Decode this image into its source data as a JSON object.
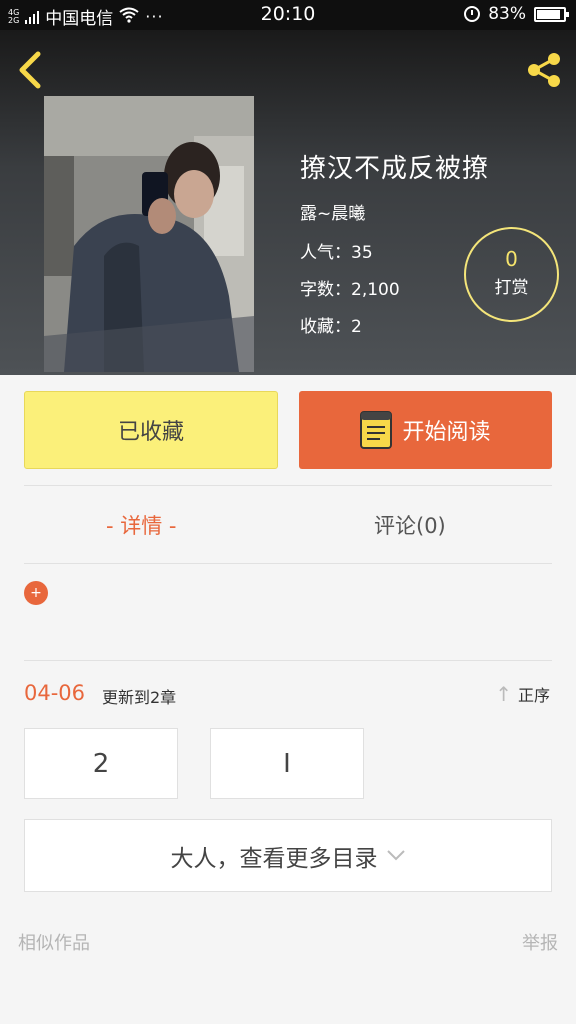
{
  "status_bar": {
    "network_top": "4G",
    "network_bottom": "2G",
    "carrier": "中国电信",
    "dots": "···",
    "time": "20:10",
    "battery": "83%",
    "battery_level": 0.83
  },
  "book": {
    "title": "撩汉不成反被撩",
    "author": "露~晨曦",
    "popularity": "人气：35",
    "word_count": "字数：2,100",
    "favorites": "收藏：2",
    "reward_count": "0",
    "reward_label": "打赏"
  },
  "actions": {
    "favorite_label": "已收藏",
    "read_label": "开始阅读"
  },
  "tabs": {
    "details": "- 详情 -",
    "comments": "评论(0)"
  },
  "update": {
    "date": "04-06",
    "text": "更新到2章",
    "sort_label": "正序"
  },
  "chapters": [
    "2",
    "I"
  ],
  "more_label": "大人，查看更多目录",
  "footer": {
    "similar": "相似作品",
    "report": "举报"
  },
  "colors": {
    "accent": "#e8673c",
    "favorite_bg": "#fbf07a",
    "icon_yellow": "#f7d849"
  }
}
